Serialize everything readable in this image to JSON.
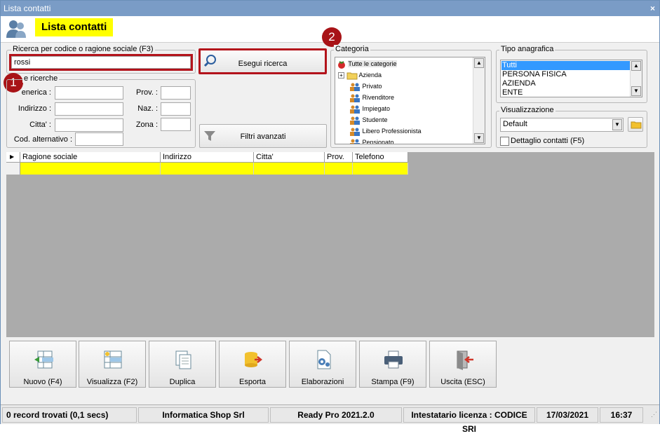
{
  "window": {
    "title": "Lista contatti",
    "close": "×"
  },
  "header": {
    "title": "Lista contatti"
  },
  "search": {
    "group_label": "Ricerca per codice o ragione sociale (F3)",
    "value": "rossi",
    "badge": "1",
    "run_label": "Esegui ricerca",
    "run_badge": "2"
  },
  "other_search": {
    "group_label": "Altre ricerche",
    "visible_group_label": "e ricerche",
    "fields": {
      "generica": "Generica :",
      "generica_visible": "enerica :",
      "indirizzo": "Indirizzo :",
      "citta": "Citta' :",
      "cod_alt": "Cod. alternativo :",
      "prov": "Prov. :",
      "naz": "Naz. :",
      "zona": "Zona :"
    },
    "filters_label": "Filtri avanzati"
  },
  "categoria": {
    "group_label": "Categoria",
    "items": [
      "Tutte le categorie",
      "Azienda",
      "Privato",
      "Rivenditore",
      "Impiegato",
      "Studente",
      "Libero Professionista",
      "Pensionato"
    ]
  },
  "tipo_anagrafica": {
    "group_label": "Tipo anagrafica",
    "items": [
      "Tutti",
      "PERSONA FISICA",
      "AZIENDA",
      "ENTE"
    ],
    "selected": "Tutti"
  },
  "visualizzazione": {
    "group_label": "Visualizzazione",
    "selected": "Default",
    "detail_label": "Dettaglio contatti (F5)"
  },
  "grid": {
    "columns": [
      "Ragione sociale",
      "Indirizzo",
      "Citta'",
      "Prov.",
      "Telefono"
    ]
  },
  "toolbar": {
    "buttons": [
      "Nuovo (F4)",
      "Visualizza (F2)",
      "Duplica",
      "Esporta",
      "Elaborazioni",
      "Stampa (F9)",
      "Uscita (ESC)"
    ]
  },
  "status": {
    "records": "0 record trovati (0,1 secs)",
    "company": "Informatica Shop Srl",
    "version": "Ready Pro 2021.2.0",
    "license": "Intestatario licenza : CODICE SRI",
    "date": "17/03/2021",
    "time": "16:37"
  },
  "colors": {
    "accent_yellow": "#ffff00",
    "highlight_red": "#b3131b",
    "titlebar": "#7a9cc6",
    "selection": "#3399ff"
  }
}
